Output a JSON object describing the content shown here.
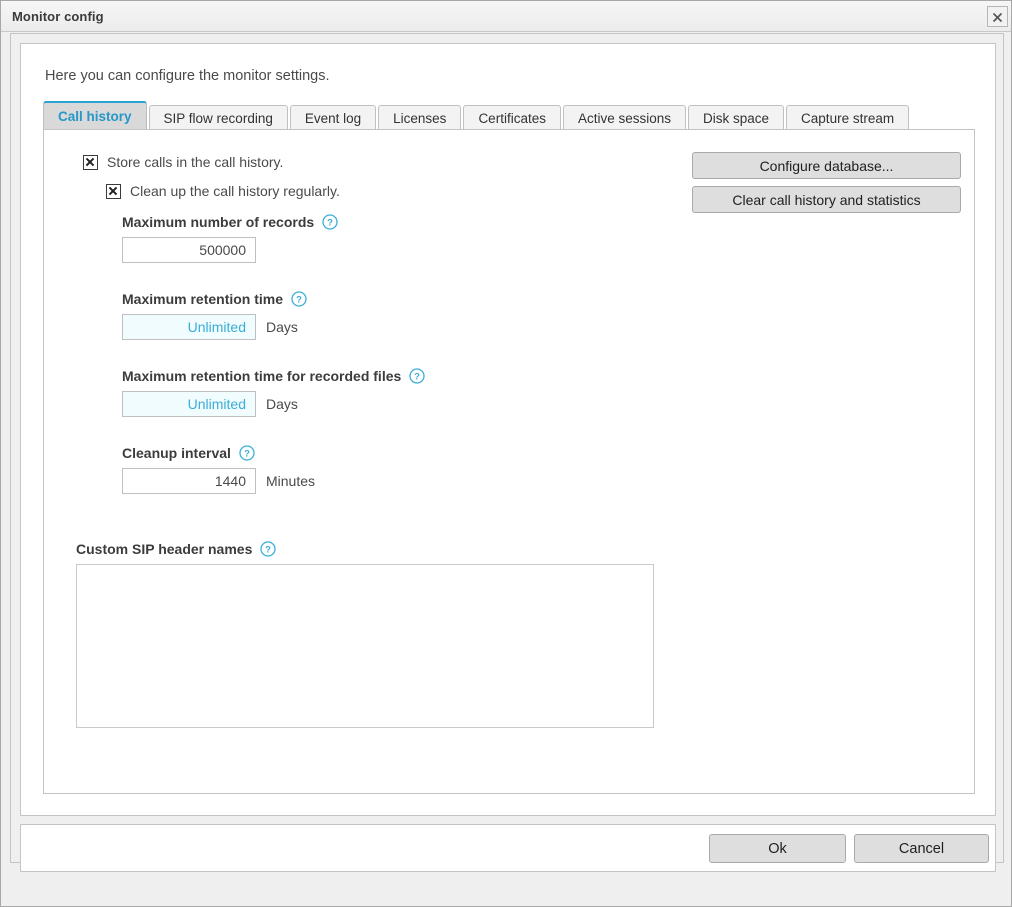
{
  "window": {
    "title": "Monitor config",
    "close_icon": "close-x-icon"
  },
  "content": {
    "intro": "Here you can configure the monitor settings."
  },
  "tabs": [
    {
      "label": "Call history",
      "active": true
    },
    {
      "label": "SIP flow recording",
      "active": false
    },
    {
      "label": "Event log",
      "active": false
    },
    {
      "label": "Licenses",
      "active": false
    },
    {
      "label": "Certificates",
      "active": false
    },
    {
      "label": "Active sessions",
      "active": false
    },
    {
      "label": "Disk space",
      "active": false
    },
    {
      "label": "Capture stream",
      "active": false
    }
  ],
  "call_history": {
    "checkboxes": [
      {
        "label": "Store calls in the call history.",
        "checked": true
      },
      {
        "label": "Clean up the call history regularly.",
        "checked": true
      }
    ],
    "fields": {
      "max_records": {
        "label": "Maximum number of records",
        "value": "500000",
        "unit": "",
        "help_icon": "help-circle-icon"
      },
      "max_retention": {
        "label": "Maximum retention time",
        "value": "Unlimited",
        "unit": "Days",
        "help_icon": "help-circle-icon"
      },
      "max_retention_files": {
        "label": "Maximum retention time for recorded files",
        "value": "Unlimited",
        "unit": "Days",
        "help_icon": "help-circle-icon"
      },
      "cleanup_interval": {
        "label": "Cleanup interval",
        "value": "1440",
        "unit": "Minutes",
        "help_icon": "help-circle-icon"
      },
      "custom_sip_headers": {
        "label": "Custom SIP header names",
        "value": "",
        "help_icon": "help-circle-icon"
      }
    },
    "actions": {
      "configure_database": "Configure database...",
      "clear_history": "Clear call history and statistics"
    }
  },
  "footer": {
    "ok": "Ok",
    "cancel": "Cancel"
  },
  "colors": {
    "accent": "#2ca2d4",
    "unlimited_text": "#3aaed8",
    "unlimited_bg": "#f0fcfd",
    "button_face": "#dedede",
    "active_tab_bg": "#d9d9d9"
  }
}
